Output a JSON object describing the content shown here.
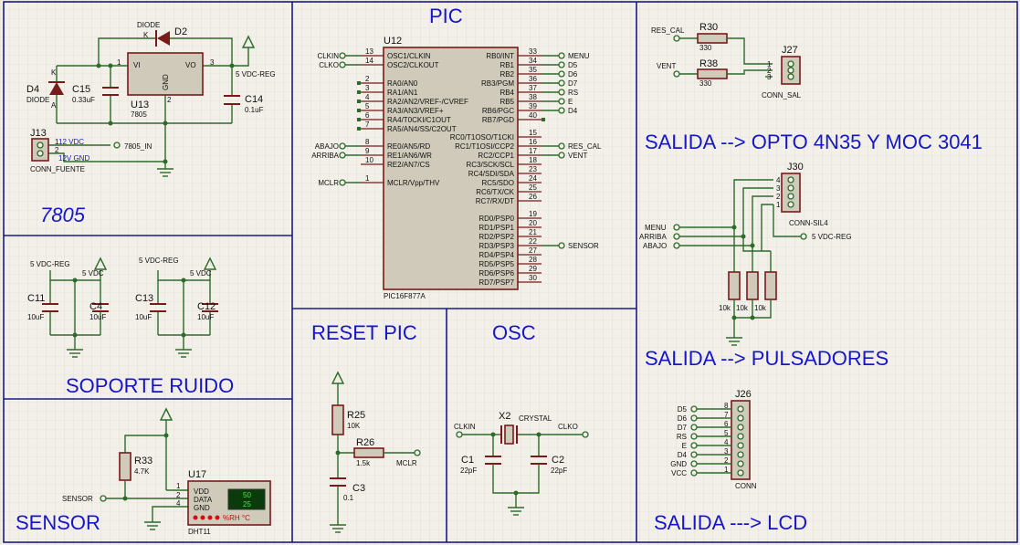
{
  "sections": {
    "pic": "PIC",
    "regulator": "7805",
    "noise": "SOPORTE RUIDO",
    "sensor": "SENSOR",
    "reset": "RESET PIC",
    "osc": "OSC",
    "out_opto": "SALIDA --> OPTO 4N35 Y MOC 3041",
    "out_buttons": "SALIDA --> PULSADORES",
    "out_lcd": "SALIDA --->  LCD"
  },
  "regulator": {
    "d2_type": "DIODE",
    "d2_ref": "D2",
    "d2_k": "K",
    "vi": "VI",
    "vo": "VO",
    "pin1": "1",
    "pin2": "2",
    "pin3": "3",
    "gnd_label": "GND",
    "u13_ref": "U13",
    "u13_value": "7805",
    "c15_ref": "C15",
    "c15_value": "0.33uF",
    "c14_ref": "C14",
    "c14_value": "0.1uF",
    "d4_ref": "D4",
    "d4_type": "DIODE",
    "d4_k": "K",
    "d4_a": "A",
    "net_out": "5 VDC-REG",
    "j13_ref": "J13",
    "j13_pin1": "1",
    "j13_pin2": "2",
    "j13_12vdc": "12 VDC",
    "j13_12vgnd": "12V GND",
    "j13_value": "CONN_FUENTE",
    "net_in": "7805_IN"
  },
  "noise": {
    "net_reg": "5 VDC-REG",
    "net_vdc": "5 VDC",
    "c11_ref": "C11",
    "c11_value": "10uF",
    "c4_ref": "C4",
    "c4_value": "10uF",
    "c13_ref": "C13",
    "c13_value": "10uF",
    "c12_ref": "C12",
    "c12_value": "10uF"
  },
  "sensor": {
    "r33_ref": "R33",
    "r33_value": "4.7K",
    "net": "SENSOR",
    "u17_ref": "U17",
    "vdd": "VDD",
    "data_pin": "DATA",
    "gnd": "GND",
    "pin1": "1",
    "pin2": "2",
    "pin4": "4",
    "display_hum": "50",
    "display_temp": "25",
    "units": "%RH  °C",
    "u17_value": "DHT11"
  },
  "pic": {
    "ref": "U12",
    "part": "PIC16F877A",
    "left_pins": [
      {
        "num": "13",
        "name": "OSC1/CLKIN",
        "net": "CLKIN",
        "term": true
      },
      {
        "num": "14",
        "name": "OSC2/CLKOUT",
        "net": "CLKO",
        "term": true
      },
      {
        "num": "2",
        "name": "RA0/AN0",
        "net": "",
        "term": false
      },
      {
        "num": "3",
        "name": "RA1/AN1",
        "net": "",
        "term": false
      },
      {
        "num": "4",
        "name": "RA2/AN2/VREF-/CVREF",
        "net": "",
        "term": false
      },
      {
        "num": "5",
        "name": "RA3/AN3/VREF+",
        "net": "",
        "term": false
      },
      {
        "num": "6",
        "name": "RA4/T0CKI/C1OUT",
        "net": "",
        "term": false
      },
      {
        "num": "7",
        "name": "RA5/AN4/SS/C2OUT",
        "net": "",
        "term": false
      },
      {
        "num": "8",
        "name": "RE0/AN5/RD",
        "net": "ABAJO",
        "term": true
      },
      {
        "num": "9",
        "name": "RE1/AN6/WR",
        "net": "ARRIBA",
        "term": true
      },
      {
        "num": "10",
        "name": "RE2/AN7/CS",
        "net": "",
        "term": false
      },
      {
        "num": "1",
        "name": "MCLR/Vpp/THV",
        "net": "MCLR",
        "term": true
      }
    ],
    "right_pins": [
      {
        "num": "33",
        "name": "RB0/INT",
        "net": "MENU",
        "term": true
      },
      {
        "num": "34",
        "name": "RB1",
        "net": "D5",
        "term": true
      },
      {
        "num": "35",
        "name": "RB2",
        "net": "D6",
        "term": true
      },
      {
        "num": "36",
        "name": "RB3/PGM",
        "net": "D7",
        "term": true
      },
      {
        "num": "37",
        "name": "RB4",
        "net": "RS",
        "term": true
      },
      {
        "num": "38",
        "name": "RB5",
        "net": "E",
        "term": true
      },
      {
        "num": "39",
        "name": "RB6/PGC",
        "net": "D4",
        "term": true
      },
      {
        "num": "40",
        "name": "RB7/PGD",
        "net": "",
        "term": false
      },
      {
        "num": "15",
        "name": "RC0/T1OSO/T1CKI",
        "net": "",
        "term": false
      },
      {
        "num": "16",
        "name": "RC1/T1OSI/CCP2",
        "net": "RES_CAL",
        "term": true
      },
      {
        "num": "17",
        "name": "RC2/CCP1",
        "net": "VENT",
        "term": true
      },
      {
        "num": "18",
        "name": "RC3/SCK/SCL",
        "net": "",
        "term": false
      },
      {
        "num": "23",
        "name": "RC4/SDI/SDA",
        "net": "",
        "term": false
      },
      {
        "num": "24",
        "name": "RC5/SDO",
        "net": "",
        "term": false
      },
      {
        "num": "25",
        "name": "RC6/TX/CK",
        "net": "",
        "term": false
      },
      {
        "num": "26",
        "name": "RC7/RX/DT",
        "net": "",
        "term": false
      },
      {
        "num": "19",
        "name": "RD0/PSP0",
        "net": "",
        "term": false
      },
      {
        "num": "20",
        "name": "RD1/PSP1",
        "net": "",
        "term": false
      },
      {
        "num": "21",
        "name": "RD2/PSP2",
        "net": "",
        "term": false
      },
      {
        "num": "22",
        "name": "RD3/PSP3",
        "net": "SENSOR",
        "term": true
      },
      {
        "num": "27",
        "name": "RD4/PSP4",
        "net": "",
        "term": false
      },
      {
        "num": "28",
        "name": "RD5/PSP5",
        "net": "",
        "term": false
      },
      {
        "num": "29",
        "name": "RD6/PSP6",
        "net": "",
        "term": false
      },
      {
        "num": "30",
        "name": "RD7/PSP7",
        "net": "",
        "term": false
      }
    ]
  },
  "reset": {
    "r25_ref": "R25",
    "r25_value": "10K",
    "r26_ref": "R26",
    "r26_value": "1.5k",
    "net": "MCLR",
    "c3_ref": "C3",
    "c3_value": "0.1"
  },
  "osc": {
    "x2_ref": "X2",
    "x2_type": "CRYSTAL",
    "clkin": "CLKIN",
    "clko": "CLKO",
    "c1_ref": "C1",
    "c1_value": "22pF",
    "c2_ref": "C2",
    "c2_value": "22pF"
  },
  "opto": {
    "res_cal": "RES_CAL",
    "vent": "VENT",
    "r30_ref": "R30",
    "r30_value": "330",
    "r38_ref": "R38",
    "r38_value": "330",
    "j27_ref": "J27",
    "pin1": "1",
    "pin2": "2",
    "pin3": "3",
    "j27_value": "CONN_SAL"
  },
  "buttons": {
    "j30_ref": "J30",
    "pin1": "1",
    "pin2": "2",
    "pin3": "3",
    "pin4": "4",
    "j30_value": "CONN-SIL4",
    "menu": "MENU",
    "arriba": "ARRIBA",
    "abajo": "ABAJO",
    "net_reg": "5 VDC-REG",
    "r_value": "10k"
  },
  "lcd": {
    "j26_ref": "J26",
    "j26_value": "CONN",
    "pins": [
      {
        "num": "8",
        "net": "D5"
      },
      {
        "num": "7",
        "net": "D6"
      },
      {
        "num": "6",
        "net": "D7"
      },
      {
        "num": "5",
        "net": "RS"
      },
      {
        "num": "4",
        "net": "E"
      },
      {
        "num": "3",
        "net": "D4"
      },
      {
        "num": "2",
        "net": "GND"
      },
      {
        "num": "1",
        "net": "VCC"
      }
    ]
  }
}
